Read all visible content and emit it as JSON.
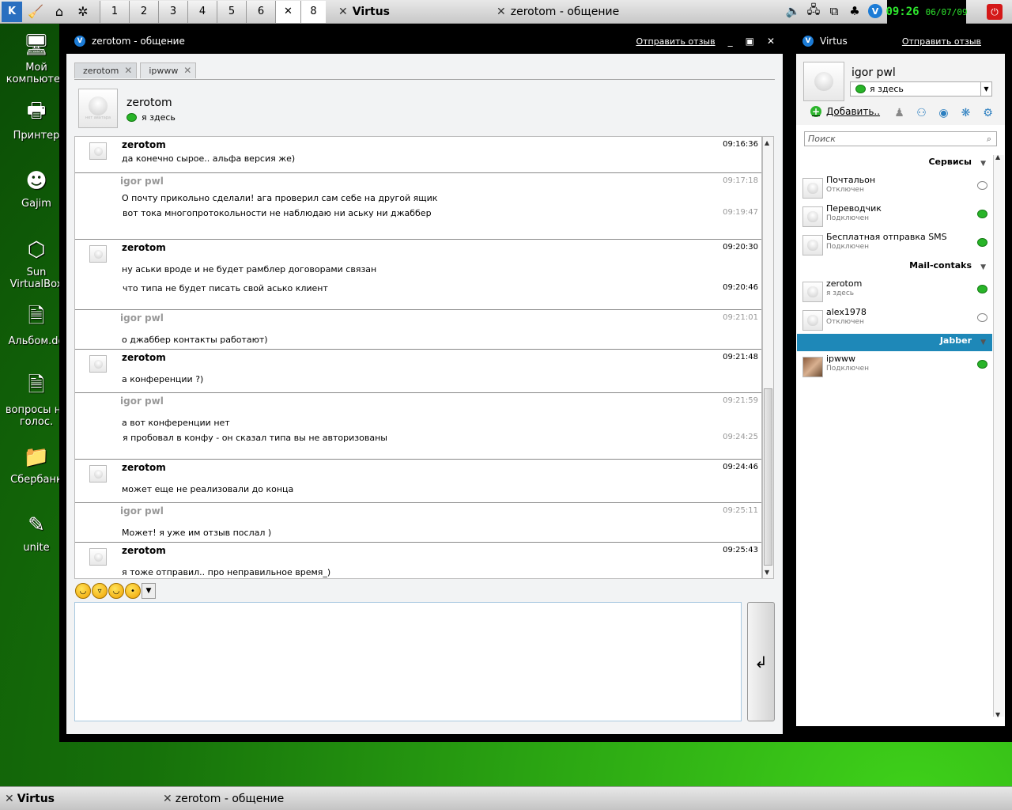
{
  "top_panel": {
    "desktops": [
      "1",
      "2",
      "3",
      "4",
      "5",
      "6"
    ],
    "pager_badge": "8",
    "tasks": [
      {
        "label": "Virtus",
        "bold": true
      },
      {
        "label": "zerotom - общение",
        "bold": false
      }
    ],
    "clock_time": "09:26",
    "clock_date": "06/07/09"
  },
  "desktop_icons": [
    {
      "label": "Мой компьютер",
      "icon": "computer-icon"
    },
    {
      "label": "Принтер",
      "icon": "printer-icon"
    },
    {
      "label": "Gajim",
      "icon": "gajim-icon"
    },
    {
      "label": "Sun VirtualBox",
      "icon": "virtualbox-icon"
    },
    {
      "label": "Альбом.do",
      "icon": "document-icon"
    },
    {
      "label": "вопросы на голос.",
      "icon": "document-icon"
    },
    {
      "label": "Сбербанк",
      "icon": "folder-icon"
    },
    {
      "label": "unite",
      "icon": "notepad-icon"
    }
  ],
  "chat_window": {
    "title": "zerotom - общение",
    "feedback": "Отправить отзыв",
    "tabs": [
      {
        "label": "zerotom",
        "active": true
      },
      {
        "label": "ipwww",
        "active": false
      }
    ],
    "contact_name": "zerotom",
    "contact_status": "я здесь",
    "avatar_caption": "нет аватара",
    "messages": [
      {
        "from": "zerotom",
        "me": false,
        "lines": [
          {
            "text": "да конечно сырое.. альфа версия же)",
            "time": "09:16:36"
          }
        ]
      },
      {
        "from": "igor pwl",
        "me": true,
        "lines": [
          {
            "text": "О почту прикольно сделали! ага проверил сам себе на другой ящик",
            "time": "09:17:18"
          },
          {
            "text": "вот тока многопротокольности не наблюдаю ни аську ни джаббер",
            "time": "09:19:47"
          }
        ]
      },
      {
        "from": "zerotom",
        "me": false,
        "lines": [
          {
            "text": "ну аськи вроде и не будет рамблер договорами связан",
            "time": "09:20:30"
          },
          {
            "text": "что типа не будет писать свой аськo клиент",
            "time": "09:20:46"
          }
        ]
      },
      {
        "from": "igor pwl",
        "me": true,
        "lines": [
          {
            "text": "о джаббер контакты работают)",
            "time": "09:21:01"
          }
        ]
      },
      {
        "from": "zerotom",
        "me": false,
        "lines": [
          {
            "text": "а конференции ?)",
            "time": "09:21:48"
          }
        ]
      },
      {
        "from": "igor pwl",
        "me": true,
        "lines": [
          {
            "text": "а вот конференции нет",
            "time": "09:21:59"
          },
          {
            "text": "я пробовал в конфу - он сказал типа вы не авторизованы",
            "time": "09:24:25"
          }
        ]
      },
      {
        "from": "zerotom",
        "me": false,
        "lines": [
          {
            "text": "может еще не реализовали до конца",
            "time": "09:24:46"
          }
        ]
      },
      {
        "from": "igor pwl",
        "me": true,
        "lines": [
          {
            "text": "Может! я уже им отзыв послал )",
            "time": "09:25:11"
          }
        ]
      },
      {
        "from": "zerotom",
        "me": false,
        "lines": [
          {
            "text": "я тоже отправил.. про неправильное время_)",
            "time": "09:25:43"
          }
        ]
      }
    ],
    "input_value": ""
  },
  "roster": {
    "title": "Virtus",
    "feedback": "Отправить отзыв",
    "user_name": "igor pwl",
    "status": "я здесь",
    "add_label": "Добавить..",
    "search_placeholder": "Поиск",
    "groups": [
      {
        "name": "Сервисы",
        "selected": false,
        "contacts": [
          {
            "name": "Почтальон",
            "status": "Отключен",
            "online": false
          },
          {
            "name": "Переводчик",
            "status": "Подключен",
            "online": true
          },
          {
            "name": "Бесплатная отправка SMS",
            "status": "Подключен",
            "online": true
          }
        ]
      },
      {
        "name": "Mail-contaks",
        "selected": false,
        "contacts": [
          {
            "name": "zerotom",
            "status": "я здесь",
            "online": true
          },
          {
            "name": "alex1978",
            "status": "Отключен",
            "online": false
          }
        ]
      },
      {
        "name": "Jabber",
        "selected": true,
        "contacts": [
          {
            "name": "ipwww",
            "status": "Подключен",
            "online": true
          }
        ]
      }
    ]
  },
  "bottom_panel": {
    "tasks": [
      {
        "label": "Virtus",
        "bold": true
      },
      {
        "label": "zerotom - общение",
        "bold": false
      }
    ]
  },
  "colors": {
    "accent": "#1e88b8",
    "clock": "#2ee62e",
    "online": "#28b428"
  }
}
